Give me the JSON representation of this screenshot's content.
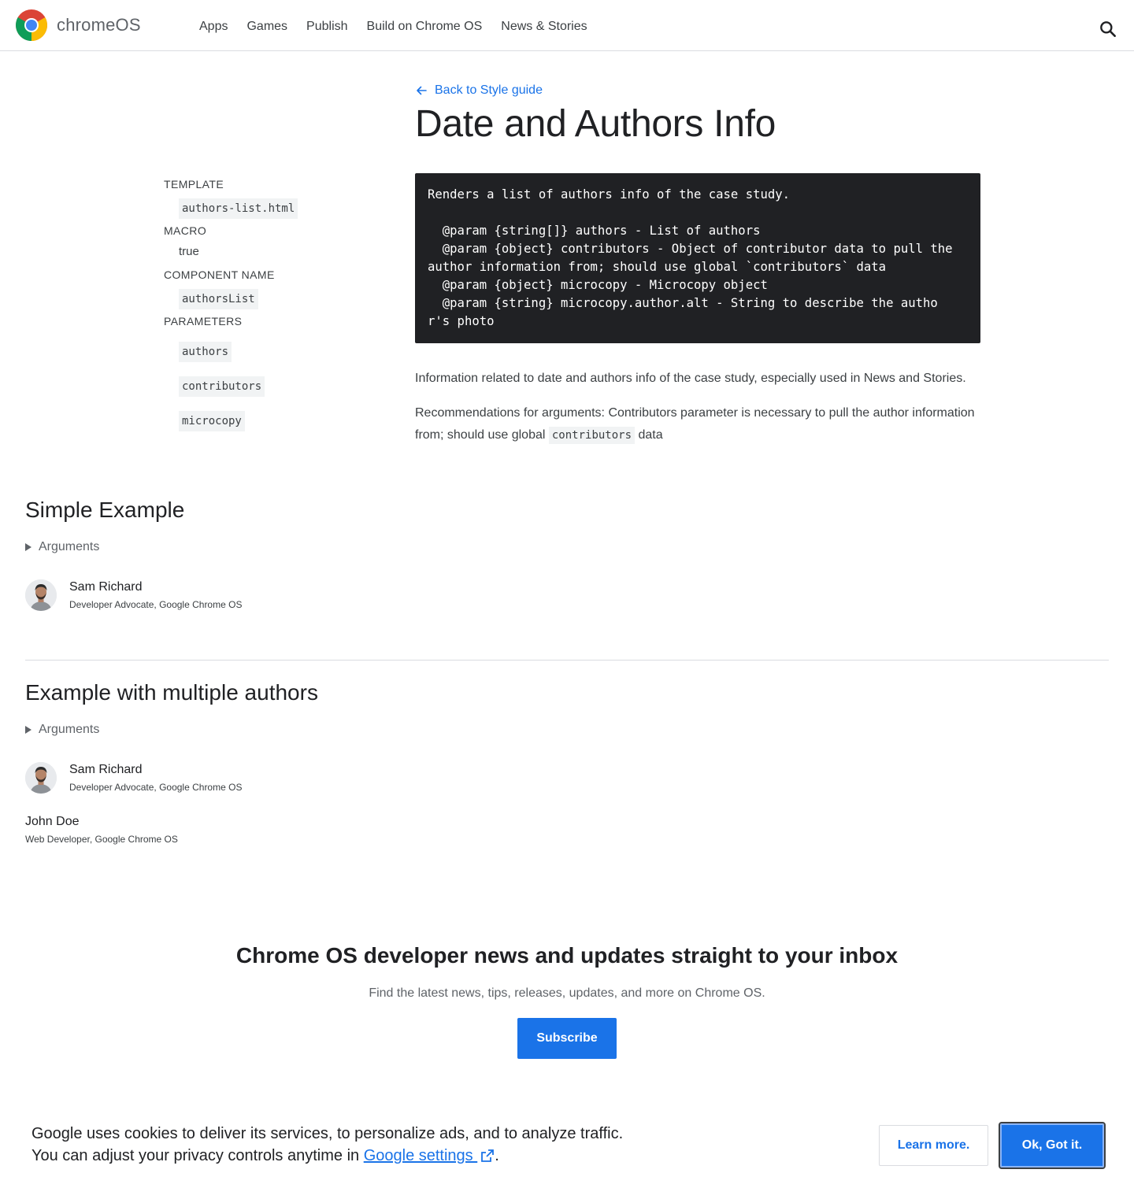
{
  "header": {
    "brand": "chromeOS",
    "nav": [
      "Apps",
      "Games",
      "Publish",
      "Build on Chrome OS",
      "News & Stories"
    ]
  },
  "page": {
    "back_link": "Back to Style guide",
    "title": "Date and Authors Info"
  },
  "meta": {
    "template_label": "TEMPLATE",
    "template_value": "authors-list.html",
    "macro_label": "MACRO",
    "macro_value": "true",
    "component_label": "COMPONENT NAME",
    "component_value": "authorsList",
    "parameters_label": "PARAMETERS",
    "parameters": [
      "authors",
      "contributors",
      "microcopy"
    ]
  },
  "code_block": "Renders a list of authors info of the case study.\n\n  @param {string[]} authors - List of authors\n  @param {object} contributors - Object of contributor data to pull the\nauthor information from; should use global `contributors` data\n  @param {object} microcopy - Microcopy object\n  @param {string} microcopy.author.alt - String to describe the autho\nr's photo",
  "description": {
    "para1": "Information related to date and authors info of the case study, especially used in News and Stories.",
    "para2_before": "Recommendations for arguments: Contributors parameter is necessary to pull the author information from; should use global ",
    "para2_code": "contributors",
    "para2_after": " data"
  },
  "examples": [
    {
      "title": "Simple Example",
      "arguments_label": "Arguments",
      "authors": [
        {
          "name": "Sam Richard",
          "role": "Developer Advocate, Google Chrome OS"
        }
      ]
    },
    {
      "title": "Example with multiple authors",
      "arguments_label": "Arguments",
      "authors": [
        {
          "name": "Sam Richard",
          "role": "Developer Advocate, Google Chrome OS"
        },
        {
          "name": "John Doe",
          "role": "Web Developer, Google Chrome OS"
        }
      ]
    }
  ],
  "newsletter": {
    "title": "Chrome OS developer news and updates straight to your inbox",
    "subtitle": "Find the latest news, tips, releases, updates, and more on Chrome OS.",
    "button": "Subscribe"
  },
  "cookie": {
    "line1": "Google uses cookies to deliver its services, to personalize ads, and to analyze traffic.",
    "line2_before": "You can adjust your privacy controls anytime in ",
    "link": "Google settings ",
    "line2_after": ".",
    "learn_more": "Learn more.",
    "ok": "Ok, Got it."
  },
  "colors": {
    "accent": "#1a73e8",
    "code_bg": "#202124",
    "text": "#202124",
    "muted": "#5f6368"
  }
}
